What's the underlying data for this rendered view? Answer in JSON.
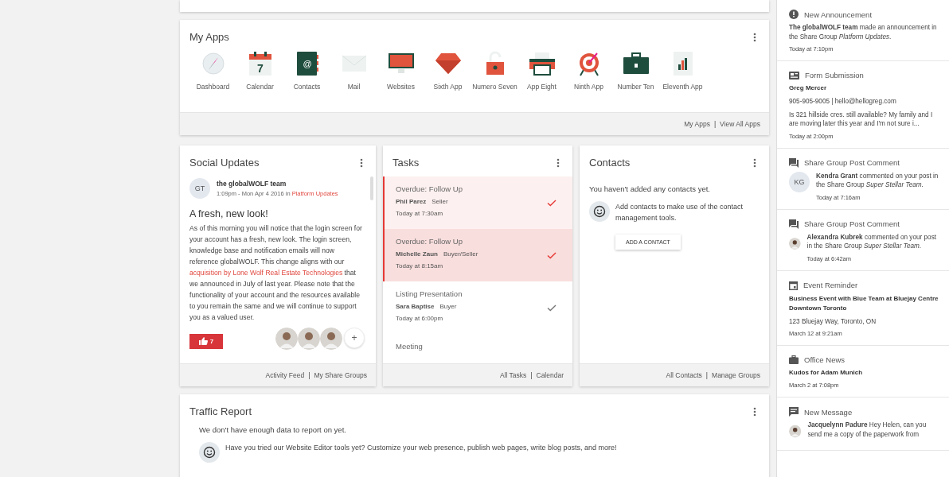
{
  "my_apps": {
    "title": "My Apps",
    "apps": [
      {
        "label": "Dashboard"
      },
      {
        "label": "Calendar",
        "icon_text": "7"
      },
      {
        "label": "Contacts",
        "icon_text": "@"
      },
      {
        "label": "Mail"
      },
      {
        "label": "Websites"
      },
      {
        "label": "Sixth App"
      },
      {
        "label": "Numero Seven"
      },
      {
        "label": "App Eight"
      },
      {
        "label": "Ninth App"
      },
      {
        "label": "Number Ten"
      },
      {
        "label": "Eleventh App"
      }
    ],
    "links": [
      "My Apps",
      "View All Apps"
    ],
    "separator": "|"
  },
  "social": {
    "title": "Social Updates",
    "avatar": "GT",
    "author": "the globalWOLF team",
    "posted": "1:09pm - Mon Apr 4 2016 in ",
    "group": "Platform Updates",
    "headline": "A fresh, new look!",
    "body_before": "As of this morning you will notice that the login screen for your account has a  fresh, new look. The login screen, knowledge base and notification emails will now reference globalWOLF. This change aligns with our ",
    "body_link": "acquisition by Lone Wolf Real Estate Technologies",
    "body_after": " that we announced in July of last year. Please note that the functionality of your account and the resources available to you remain the same and we will continue to support you as a valued user.",
    "likes": "7",
    "add": "+",
    "links": [
      "Activity Feed",
      "My Share Groups"
    ],
    "separator": "|"
  },
  "tasks": {
    "title": "Tasks",
    "items": [
      {
        "title": "Overdue: Follow Up",
        "name": "Phil Parez",
        "role": "Seller",
        "time": "Today at 7:30am",
        "overdue": true,
        "selected": false
      },
      {
        "title": "Overdue: Follow Up",
        "name": "Michelle Zaun",
        "role": "Buyer/Seller",
        "time": "Today at 8:15am",
        "overdue": true,
        "selected": true
      },
      {
        "title": "Listing Presentation",
        "name": "Sara Baptise",
        "role": "Buyer",
        "time": "Today at 6:00pm",
        "overdue": false,
        "selected": false
      },
      {
        "title": "Meeting",
        "overdue": false,
        "selected": false
      }
    ],
    "links": [
      "All Tasks",
      "Calendar"
    ],
    "separator": "|"
  },
  "contacts": {
    "title": "Contacts",
    "empty": "You haven't added any contacts yet.",
    "hint": "Add contacts to make use of the contact management tools.",
    "button": "ADD A CONTACT",
    "links": [
      "All Contacts",
      "Manage Groups"
    ],
    "separator": "|"
  },
  "traffic": {
    "title": "Traffic Report",
    "empty": "We don't have enough data to report on yet.",
    "hint": "Have you tried our Website Editor tools yet? Customize your web presence, publish web pages, write blog posts, and more!"
  },
  "notifications": [
    {
      "kind": "announcement",
      "title": "New Announcement",
      "text": "**The globalWOLF team** made an announcement in the Share Group *Platform Updates*.",
      "time": "Today at 7:10pm"
    },
    {
      "kind": "form",
      "title": "Form Submission",
      "name": "Greg Mercer",
      "contact": "905-905-9005  |  hello@hellogreg.com",
      "text": "Is 321 hillside cres. still available? My family and I are moving later this year and I'm not sure i...",
      "time": "Today at 2:00pm"
    },
    {
      "kind": "comment",
      "title": "Share Group Post Comment",
      "avatar": "KG",
      "text": "**Kendra Grant** commented on your post in the Share Group *Super Stellar Team*.",
      "time": "Today at 7:16am"
    },
    {
      "kind": "comment",
      "title": "Share Group Post Comment",
      "photo": true,
      "text": "**Alexandra Kubrek** commented on your post in the Share Group *Super Stellar Team*.",
      "time": "Today at 6:42am"
    },
    {
      "kind": "event",
      "title": "Event Reminder",
      "name": "Business Event with Blue Team at Bluejay Centre Downtown Toronto",
      "contact": "123 Bluejay Way, Toronto, ON",
      "time": "March 12 at 9:21am"
    },
    {
      "kind": "news",
      "title": "Office News",
      "name": "Kudos for Adam Munich",
      "time": "March 2 at 7:08pm"
    },
    {
      "kind": "message",
      "title": "New Message",
      "photo": true,
      "text": "**Jacquelynn Padure** Hey Helen, can you send me a copy of the paperwork from"
    }
  ]
}
